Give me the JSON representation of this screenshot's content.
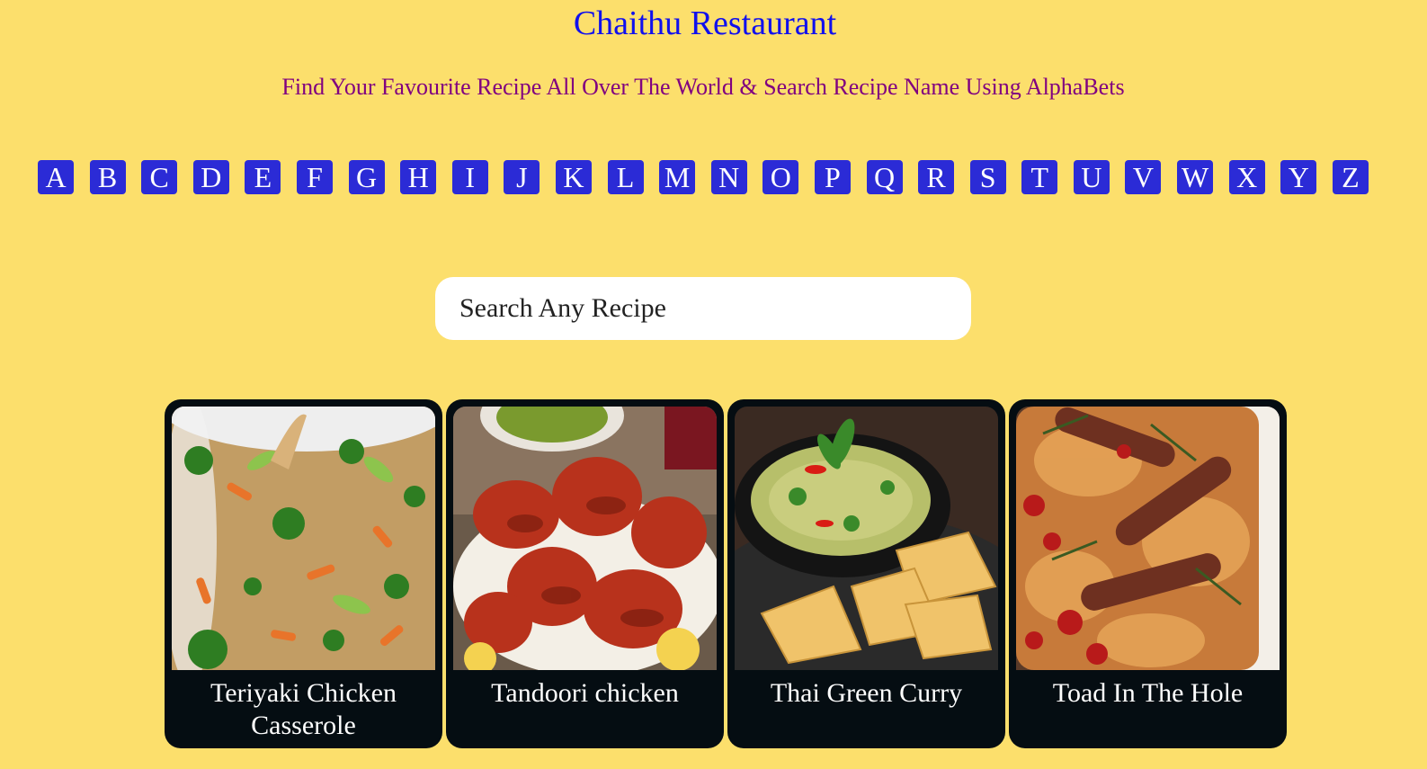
{
  "header": {
    "title": "Chaithu Restaurant",
    "subtitle": "Find Your Favourite Recipe All Over The World & Search Recipe Name Using AlphaBets"
  },
  "alphabet": [
    "A",
    "B",
    "C",
    "D",
    "E",
    "F",
    "G",
    "H",
    "I",
    "J",
    "K",
    "L",
    "M",
    "N",
    "O",
    "P",
    "Q",
    "R",
    "S",
    "T",
    "U",
    "V",
    "W",
    "X",
    "Y",
    "Z"
  ],
  "search": {
    "placeholder": "Search Any Recipe",
    "value": ""
  },
  "recipes": [
    {
      "name": "Teriyaki Chicken Casserole",
      "image_icon": "rice-vegetables-photo"
    },
    {
      "name": "Tandoori chicken",
      "image_icon": "tandoori-chicken-photo"
    },
    {
      "name": "Thai Green Curry",
      "image_icon": "green-curry-photo"
    },
    {
      "name": "Toad In The Hole",
      "image_icon": "sausage-bake-photo"
    }
  ],
  "colors": {
    "background": "#fcdf6c",
    "title": "#1010ee",
    "subtitle": "#800080",
    "alpha_button": "#2b2bd6",
    "card": "#050d12"
  }
}
